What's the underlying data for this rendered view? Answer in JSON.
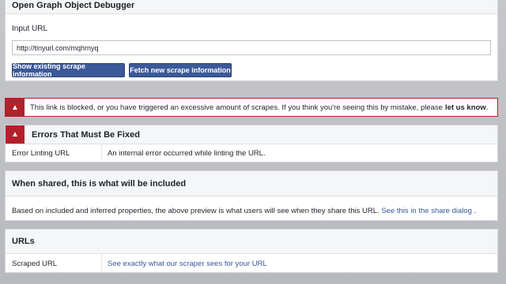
{
  "debugger": {
    "title": "Open Graph Object Debugger",
    "input_label": "Input URL",
    "input_value": "http://tinyurl.com/mqhrnyq",
    "buttons": {
      "show_existing": "Show existing scrape information",
      "fetch_new": "Fetch new scrape information"
    }
  },
  "blocked_notice": {
    "text": "This link is blocked, or you have triggered an excessive amount of scrapes. If you think you're seeing this by mistake, please ",
    "link": "let us know",
    "end": "."
  },
  "errors": {
    "title": "Errors That Must Be Fixed",
    "rows": [
      {
        "label": "Error Linting URL",
        "value": "An internal error occurred while linting the URL."
      }
    ]
  },
  "shared": {
    "title": "When shared, this is what will be included",
    "text": "Based on included and inferred properties, the above preview is what users will see when they share this URL. ",
    "link": "See this in the share dialog",
    "end": "."
  },
  "urls": {
    "title": "URLs",
    "rows": [
      {
        "label": "Scraped URL",
        "link": "See exactly what our scraper sees for your URL"
      }
    ]
  },
  "colors": {
    "accent": "#3b5998",
    "link": "#365899",
    "error": "#b3202c"
  },
  "icons": {
    "warning": "warning-icon"
  }
}
